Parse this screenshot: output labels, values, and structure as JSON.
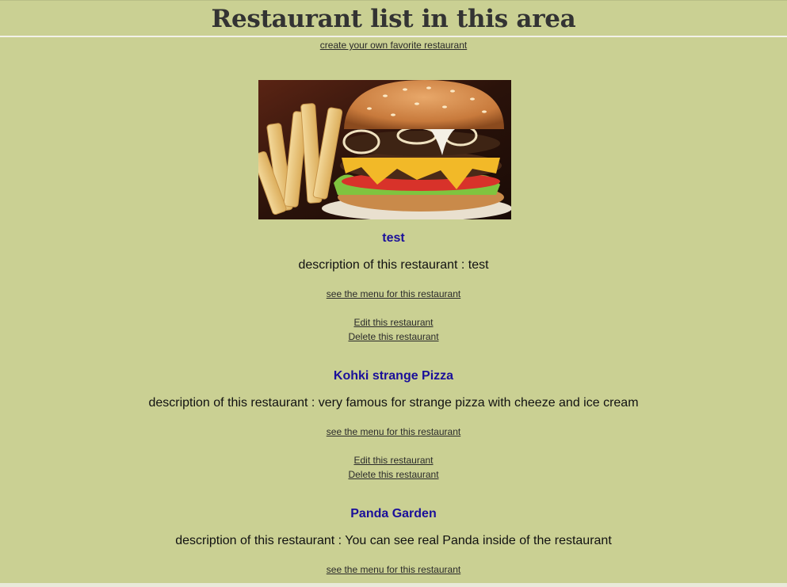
{
  "header": {
    "title": "Restaurant list in this area"
  },
  "create_link": "create your own favorite restaurant",
  "hero_image": {
    "icon": "burger-and-fries-photo"
  },
  "restaurants": [
    {
      "name": "test",
      "description": "description of this restaurant : test",
      "menu_link": "see the menu for this restaurant",
      "edit_link": "Edit this restaurant",
      "delete_link": "Delete this restaurant"
    },
    {
      "name": "Kohki strange Pizza",
      "description": "description of this restaurant : very famous for strange pizza with cheeze and ice cream",
      "menu_link": "see the menu for this restaurant",
      "edit_link": "Edit this restaurant",
      "delete_link": "Delete this restaurant"
    },
    {
      "name": "Panda Garden",
      "description": "description of this restaurant : You can see real Panda inside of the restaurant",
      "menu_link": "see the menu for this restaurant"
    }
  ],
  "colors": {
    "background": "#cad093",
    "restaurant_name": "#1a0f9a",
    "title": "#333333"
  }
}
